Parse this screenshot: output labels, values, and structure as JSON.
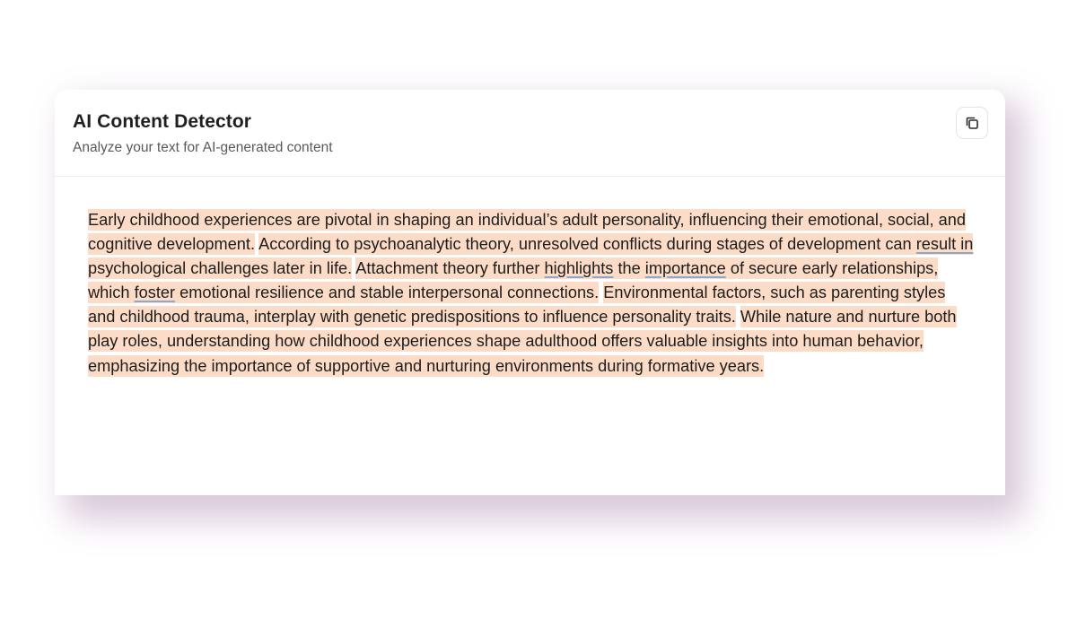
{
  "header": {
    "title": "AI Content Detector",
    "subtitle": "Analyze your text for AI-generated content",
    "copy_icon": "copy-icon"
  },
  "colors": {
    "ai_highlight": "#fcdcc6",
    "flag_underline": "#8aa9d0",
    "shadow": "#8c5a8c"
  },
  "analysis": {
    "sentences": [
      {
        "ai_generated": true,
        "parts": [
          {
            "text": "Early childhood experiences are pivotal in shaping an individual’s adult personality, influencing their emotional, social, and cognitive development.",
            "flagged": false
          }
        ]
      },
      {
        "ai_generated": true,
        "parts": [
          {
            "text": "According to psychoanalytic theory, unresolved conflicts during stages of development can ",
            "flagged": false
          },
          {
            "text": "result in",
            "flagged": true
          },
          {
            "text": " psychological challenges later in life.",
            "flagged": false
          }
        ]
      },
      {
        "ai_generated": true,
        "parts": [
          {
            "text": "Attachment theory further ",
            "flagged": false
          },
          {
            "text": "highlights",
            "flagged": true
          },
          {
            "text": " the ",
            "flagged": false
          },
          {
            "text": "importance",
            "flagged": true
          },
          {
            "text": " of secure early relationships, which ",
            "flagged": false
          },
          {
            "text": "foster",
            "flagged": true
          },
          {
            "text": " emotional resilience and stable interpersonal connections.",
            "flagged": false
          }
        ]
      },
      {
        "ai_generated": true,
        "parts": [
          {
            "text": "Environmental factors, such as parenting styles and childhood trauma, interplay with genetic predispositions to influence personality traits.",
            "flagged": false
          }
        ]
      },
      {
        "ai_generated": true,
        "parts": [
          {
            "text": "While nature and nurture both play roles, understanding how childhood experiences shape adulthood offers valuable insights into human behavior, emphasizing the importance of supportive and nurturing environments during formative years.",
            "flagged": false
          }
        ]
      }
    ]
  }
}
